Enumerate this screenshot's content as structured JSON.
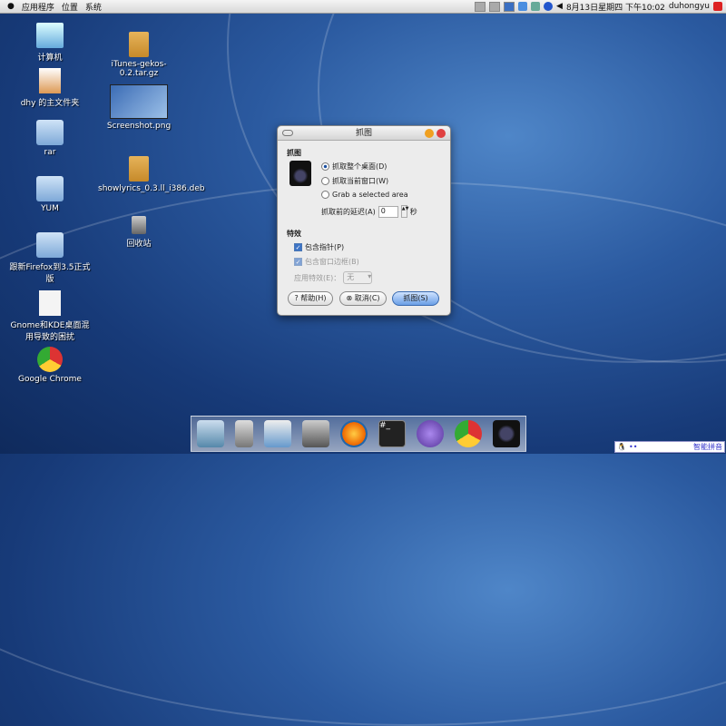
{
  "topbar": {
    "menus": [
      "应用程序",
      "位置",
      "系统"
    ],
    "clock": "8月13日星期四 下午10:02",
    "user": "duhongyu"
  },
  "desktop_icons": [
    {
      "label": "计算机",
      "icon": "computer-icon"
    },
    {
      "label": "dhy 的主文件夹",
      "icon": "home-icon"
    },
    {
      "label": "rar",
      "icon": "folder-icon"
    },
    {
      "label": "YUM",
      "icon": "folder-icon"
    },
    {
      "label": "跟新Firefox到3.5正式版",
      "icon": "folder-icon"
    },
    {
      "label": "Gnome和KDE桌面混用导致的困扰",
      "icon": "document-icon"
    },
    {
      "label": "Google Chrome",
      "icon": "chrome-icon"
    },
    {
      "label": "iTunes-gekos-0.2.tar.gz",
      "icon": "package-icon"
    },
    {
      "label": "Screenshot.png",
      "icon": "image-icon"
    },
    {
      "label": "showlyrics_0.3.ll_i386.deb",
      "icon": "package-icon"
    },
    {
      "label": "回收站",
      "icon": "trash-icon"
    }
  ],
  "dialog": {
    "title": "抓图",
    "section1": "抓图",
    "opt1": "抓取整个桌面(D)",
    "opt2": "抓取当前窗口(W)",
    "opt3": "Grab a selected area",
    "delay_label": "抓取前的延迟(A)",
    "delay_value": "0",
    "delay_unit": "秒",
    "section2": "特效",
    "cb1": "包含指针(P)",
    "cb2": "包含窗口边框(B)",
    "effect_label": "应用特效(E)：",
    "effect_value": "无",
    "help": "帮助(H)",
    "cancel": "取消(C)",
    "ok": "抓图(S)",
    "selected_option": 1
  },
  "dock": [
    "finder-icon",
    "trash-icon",
    "installer-icon",
    "drive-icon",
    "firefox-icon",
    "terminal-icon",
    "pidgin-icon",
    "chrome-icon",
    "camera-icon"
  ],
  "ime": {
    "label": "智能拼音"
  }
}
